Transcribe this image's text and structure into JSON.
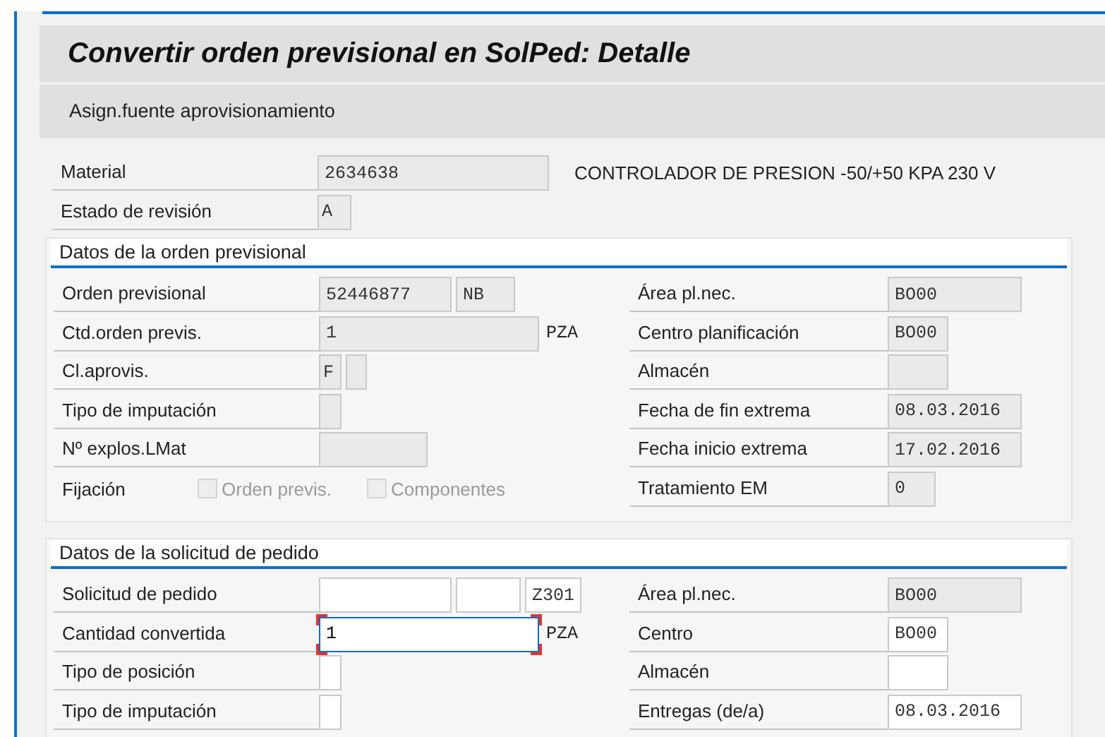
{
  "window": {
    "title": "Convertir orden previsional en SolPed: Detalle"
  },
  "toolbar": {
    "buttons": [
      "Asign.fuente aprovisionamiento"
    ]
  },
  "header": {
    "rows": [
      {
        "label": "Material",
        "fields": [
          {
            "value": "2634638",
            "editable": false,
            "focused": false
          }
        ],
        "text": "CONTROLADOR DE PRESION -50/+50 KPA 230 V"
      },
      {
        "label": "Estado de revisión",
        "fields": [
          {
            "value": "A",
            "editable": false,
            "focused": false
          }
        ]
      }
    ]
  },
  "sections": [
    {
      "title": "Datos de la orden previsional",
      "left": [
        {
          "kind": "field",
          "label": "Orden previsional",
          "fields": [
            {
              "value": "52446877",
              "editable": false,
              "focused": false
            },
            {
              "value": "NB",
              "editable": false,
              "focused": false
            }
          ]
        },
        {
          "kind": "field",
          "label": "Ctd.orden previs.",
          "fields": [
            {
              "value": "1",
              "editable": false,
              "focused": false
            }
          ],
          "unit": "PZA"
        },
        {
          "kind": "field",
          "label": "Cl.aprovis.",
          "fields": [
            {
              "value": "F",
              "editable": false,
              "focused": false
            },
            {
              "editable": false,
              "focused": false
            }
          ]
        },
        {
          "kind": "field",
          "label": "Tipo de imputación",
          "fields": [
            {
              "editable": false,
              "focused": false
            }
          ]
        },
        {
          "kind": "field",
          "label": "Nº explos.LMat",
          "fields": [
            {
              "editable": false,
              "focused": false
            }
          ]
        },
        {
          "kind": "checkboxes",
          "label": "Fijación",
          "checkboxes": [
            {
              "label": "Orden previs.",
              "checked": false,
              "disabled": true
            },
            {
              "label": "Componentes",
              "checked": false,
              "disabled": true
            }
          ]
        }
      ],
      "right": [
        {
          "label": "Área pl.nec.",
          "fields": [
            {
              "value": "BO00",
              "editable": false,
              "focused": false
            }
          ]
        },
        {
          "label": "Centro planificación",
          "fields": [
            {
              "value": "BO00",
              "editable": false,
              "focused": false
            }
          ]
        },
        {
          "label": "Almacén",
          "fields": [
            {
              "editable": false,
              "focused": false
            }
          ]
        },
        {
          "label": "Fecha de fin extrema",
          "fields": [
            {
              "value": "08.03.2016",
              "editable": false,
              "focused": false
            }
          ]
        },
        {
          "label": "Fecha inicio extrema",
          "fields": [
            {
              "value": "17.02.2016",
              "editable": false,
              "focused": false
            }
          ]
        },
        {
          "label": "Tratamiento EM",
          "fields": [
            {
              "value": "0",
              "editable": false,
              "focused": false
            }
          ]
        }
      ]
    },
    {
      "title": "Datos de la solicitud de pedido",
      "left": [
        {
          "label": "Solicitud de pedido",
          "fields": [
            {
              "editable": true,
              "focused": false
            },
            {
              "editable": true,
              "focused": false
            },
            {
              "value": "Z301",
              "editable": true,
              "focused": false
            }
          ]
        },
        {
          "label": "Cantidad convertida",
          "fields": [
            {
              "value": "1",
              "editable": true,
              "focused": true
            }
          ],
          "unit": "PZA"
        },
        {
          "label": "Tipo de posición",
          "fields": [
            {
              "editable": true,
              "focused": false
            }
          ]
        },
        {
          "label": "Tipo de imputación",
          "fields": [
            {
              "editable": true,
              "focused": false
            }
          ]
        }
      ],
      "right": [
        {
          "label": "Área pl.nec.",
          "fields": [
            {
              "value": "BO00",
              "editable": false,
              "focused": false
            }
          ]
        },
        {
          "label": "Centro",
          "fields": [
            {
              "value": "BO00",
              "editable": true,
              "focused": false
            }
          ]
        },
        {
          "label": "Almacén",
          "fields": [
            {
              "editable": true,
              "focused": false
            }
          ]
        },
        {
          "label": "Entregas (de/a)",
          "fields": [
            {
              "value": "08.03.2016",
              "editable": true,
              "focused": false
            }
          ]
        }
      ]
    }
  ]
}
